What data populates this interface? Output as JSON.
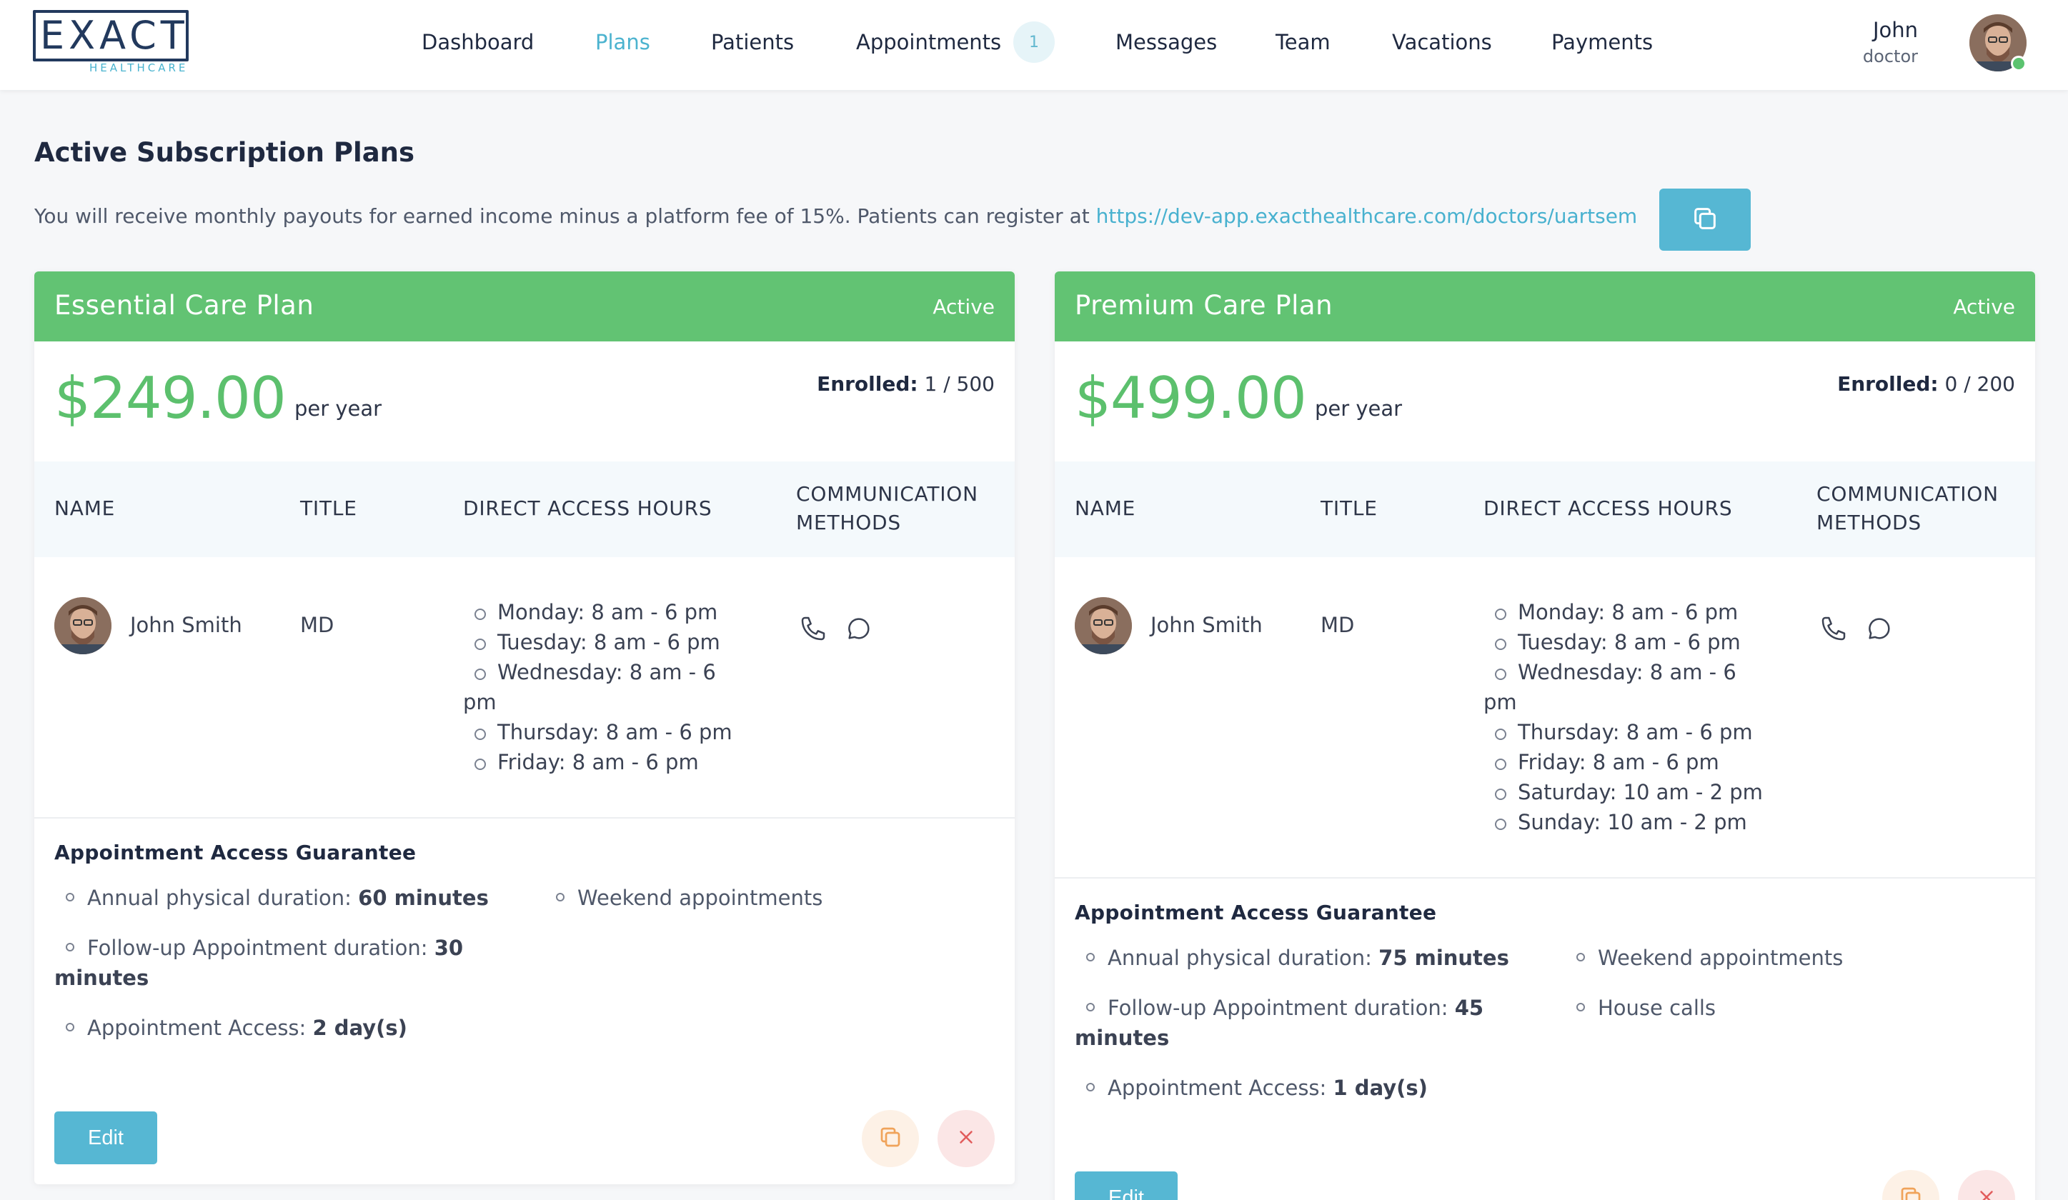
{
  "brand": {
    "logo_text": "EXACT",
    "logo_sub": "HEALTHCARE"
  },
  "nav": {
    "items": [
      {
        "label": "Dashboard"
      },
      {
        "label": "Plans"
      },
      {
        "label": "Patients"
      },
      {
        "label": "Appointments",
        "badge": "1"
      },
      {
        "label": "Messages"
      },
      {
        "label": "Team"
      },
      {
        "label": "Vacations"
      },
      {
        "label": "Payments"
      }
    ],
    "active": "Plans"
  },
  "user": {
    "name": "John",
    "role": "doctor",
    "status": "online"
  },
  "page": {
    "title": "Active Subscription Plans",
    "intro_text": "You will receive monthly payouts for earned income minus a platform fee of 15%. Patients can register at ",
    "register_url": "https://dev-app.exacthealthcare.com/doctors/uartsem",
    "copy_icon": "copy-icon"
  },
  "table_headers": {
    "name": "NAME",
    "title": "TITLE",
    "hours": "DIRECT ACCESS HOURS",
    "comm_line1": "COMMUNICATION",
    "comm_line2": "METHODS"
  },
  "plans": [
    {
      "name": "Essential Care Plan",
      "status": "Active",
      "price": "$249.00",
      "period": "per year",
      "enrolled_label": "Enrolled:",
      "enrolled_value": "1 / 500",
      "doctor": {
        "name": "John Smith",
        "title": "MD",
        "hours": [
          "Monday: 8 am - 6 pm",
          "Tuesday: 8 am - 6 pm",
          "Wednesday: 8 am - 6",
          "pm",
          "Thursday: 8 am - 6 pm",
          "Friday: 8 am - 6 pm"
        ],
        "comm_icons": [
          "phone-icon",
          "chat-icon"
        ]
      },
      "guarantee": {
        "title": "Appointment Access Guarantee",
        "annual_label": "Annual physical duration: ",
        "annual_value": "60 minutes",
        "followup_label": "Follow-up Appointment duration: ",
        "followup_value": "30",
        "followup_value2": "minutes",
        "access_label": "Appointment Access: ",
        "access_value": "2 day(s)",
        "extras": [
          "Weekend appointments"
        ]
      },
      "edit_label": "Edit"
    },
    {
      "name": "Premium Care Plan",
      "status": "Active",
      "price": "$499.00",
      "period": "per year",
      "enrolled_label": "Enrolled:",
      "enrolled_value": "0 / 200",
      "doctor": {
        "name": "John Smith",
        "title": "MD",
        "hours": [
          "Monday: 8 am - 6 pm",
          "Tuesday: 8 am - 6 pm",
          "Wednesday: 8 am - 6",
          "pm",
          "Thursday: 8 am - 6 pm",
          "Friday: 8 am - 6 pm",
          "Saturday: 10 am - 2 pm",
          "Sunday: 10 am - 2 pm"
        ],
        "comm_icons": [
          "phone-icon",
          "chat-icon"
        ]
      },
      "guarantee": {
        "title": "Appointment Access Guarantee",
        "annual_label": "Annual physical duration: ",
        "annual_value": "75 minutes",
        "followup_label": "Follow-up Appointment duration: ",
        "followup_value": "45",
        "followup_value2": "minutes",
        "access_label": "Appointment Access: ",
        "access_value": "1 day(s)",
        "extras": [
          "Weekend appointments",
          "House calls"
        ]
      },
      "edit_label": "Edit"
    }
  ],
  "colors": {
    "accent": "#56b7d3",
    "plan_header": "#62c373",
    "price": "#5cc06d",
    "nav_active": "#4cb3cf"
  }
}
